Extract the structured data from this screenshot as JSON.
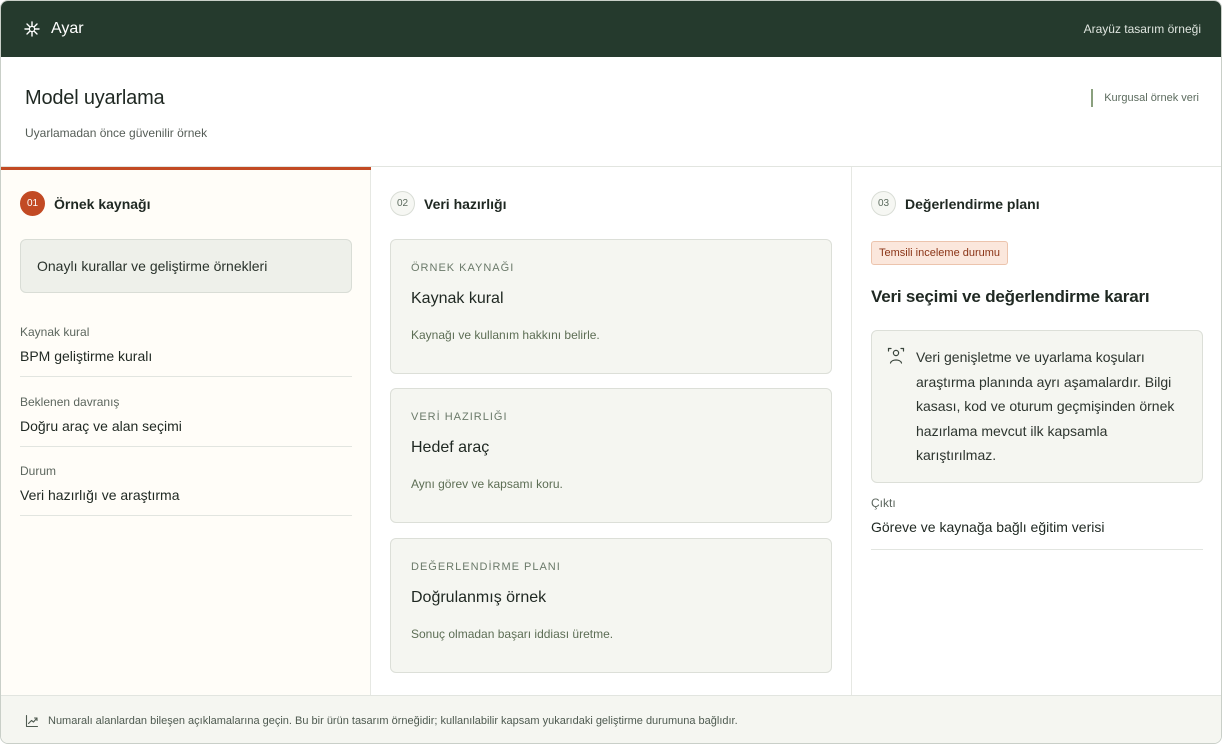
{
  "app": {
    "name": "Ayar",
    "top_right": "Arayüz tasarım örneği"
  },
  "header": {
    "title": "Model uyarlama",
    "subtitle": "Uyarlamadan önce güvenilir örnek",
    "note": "Kurgusal örnek veri"
  },
  "columns": [
    {
      "number": "01",
      "title": "Örnek kaynağı",
      "source_box": "Onaylı kurallar ve geliştirme örnekleri",
      "fields": [
        {
          "label": "Kaynak kural",
          "value": "BPM geliştirme kuralı"
        },
        {
          "label": "Beklenen davranış",
          "value": "Doğru araç ve alan seçimi"
        },
        {
          "label": "Durum",
          "value": "Veri hazırlığı ve araştırma"
        }
      ]
    },
    {
      "number": "02",
      "title": "Veri hazırlığı",
      "cards": [
        {
          "eyebrow": "ÖRNEK KAYNAĞI",
          "title": "Kaynak kural",
          "desc": "Kaynağı ve kullanım hakkını belirle."
        },
        {
          "eyebrow": "VERİ HAZIRLIĞI",
          "title": "Hedef araç",
          "desc": "Aynı görev ve kapsamı koru."
        },
        {
          "eyebrow": "DEĞERLENDİRME PLANI",
          "title": "Doğrulanmış örnek",
          "desc": "Sonuç olmadan başarı iddiası üretme."
        }
      ]
    },
    {
      "number": "03",
      "title": "Değerlendirme planı",
      "badge": "Temsili inceleme durumu",
      "decision_title": "Veri seçimi ve değerlendirme kararı",
      "note": "Veri genişletme ve uyarlama koşuları araştırma planında ayrı aşamalardır. Bilgi kasası, kod ve oturum geçmişinden örnek hazırlama mevcut ilk kapsamla karıştırılmaz.",
      "output": {
        "label": "Çıktı",
        "value": "Göreve ve kaynağa bağlı eğitim verisi"
      }
    }
  ],
  "footer": {
    "text": "Numaralı alanlardan bileşen açıklamalarına geçin. Bu bir ürün tasarım örneğidir; kullanılabilir kapsam yukarıdaki geliştirme durumuna bağlıdır."
  },
  "icons": {
    "brand": "sparkle-icon",
    "note": "person-scan-icon",
    "footer": "trend-chart-icon"
  },
  "colors": {
    "topbar": "#253a2d",
    "accent": "#c24a24",
    "badge_bg": "#fbe7dc",
    "card_bg": "#f5f6f1"
  }
}
